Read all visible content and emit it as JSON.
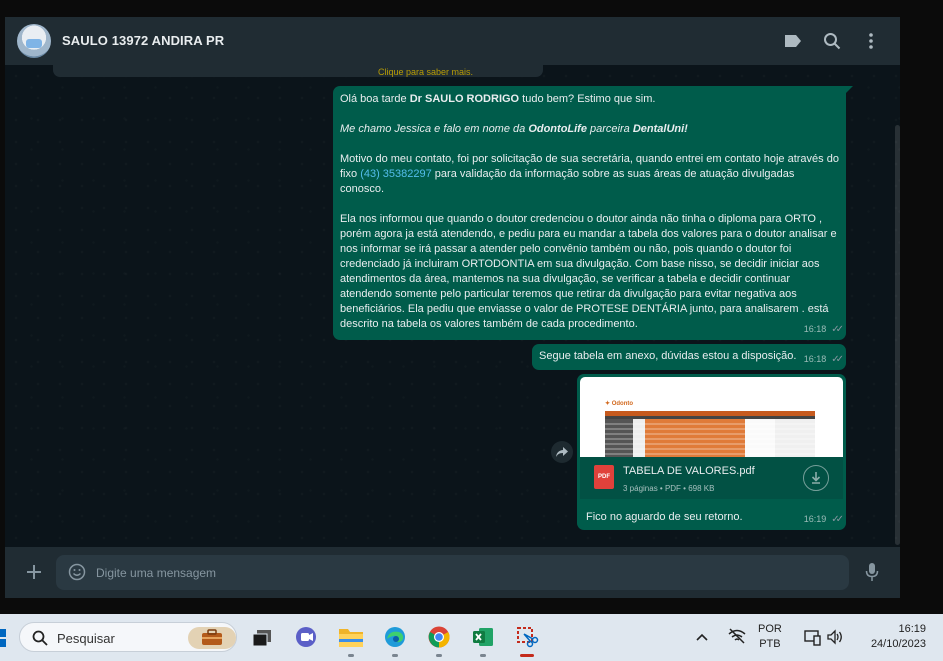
{
  "header": {
    "contact_name": "SAULO 13972 ANDIRA PR",
    "icons": [
      "label-icon",
      "search-icon",
      "menu-icon"
    ]
  },
  "chat": {
    "previous_message_fragment": "Clique para saber mais.",
    "messages": [
      {
        "paragraph1": {
          "prefix": "Olá boa tarde ",
          "bold": "Dr SAULO  RODRIGO",
          "suffix": " tudo bem? Estimo que sim."
        },
        "paragraph2": {
          "prefix": "Me chamo Jessica e falo em nome da ",
          "bold1": "OdontoLife",
          "middle": " parceira ",
          "bold2": "DentalUni!"
        },
        "paragraph3": {
          "prefix": "Motivo do meu contato, foi por solicitação de sua secretária, quando entrei em contato hoje através do fixo ",
          "phone": "(43) 35382297",
          "suffix": " para validação da informação sobre as suas áreas de atuação divulgadas conosco."
        },
        "paragraph4": "Ela nos informou que quando o doutor credenciou o doutor ainda não tinha o diploma para ORTO , porém agora ja está atendendo, e pediu para eu mandar a tabela dos valores para o doutor analisar e nos informar se irá passar a atender pelo convênio também ou não, pois quando o doutor foi credenciado já incluiram ORTODONTIA em sua divulgação. Com base nisso, se decidir iniciar aos atendimentos da área, mantemos na sua divulgação, se verificar a tabela e decidir continuar atendendo somente pelo particular teremos que retirar da divulgação para evitar negativa aos beneficiários. Ela pediu que enviasse o valor de PROTESE DENTÁRIA junto, para analisarem . está descrito na tabela os valores também de cada procedimento.",
        "time": "16:18"
      },
      {
        "text": "Segue tabela em anexo, dúvidas estou a disposição.",
        "time": "16:18"
      },
      {
        "attachment": {
          "file_name": "TABELA DE VALORES.pdf",
          "meta": "3 páginas • PDF • 698 KB",
          "badge": "PDF"
        },
        "caption": "Fico no aguardo de seu retorno.",
        "time": "16:19"
      }
    ]
  },
  "composer": {
    "placeholder": "Digite uma mensagem"
  },
  "taskbar": {
    "search_placeholder": "Pesquisar",
    "apps": [
      "briefcase-icon",
      "task-view-icon",
      "teams-icon",
      "file-explorer-icon",
      "edge-icon",
      "chrome-icon",
      "excel-icon",
      "snipping-tool-icon"
    ],
    "language": "POR",
    "keyboard": "PTB",
    "time": "16:19",
    "date": "24/10/2023"
  },
  "colors": {
    "header_bg": "#202c33",
    "chat_bg": "#0b141a",
    "outgoing_bubble": "#005c4b",
    "link": "#53bdeb",
    "taskbar_bg": "#dfe7ef"
  }
}
